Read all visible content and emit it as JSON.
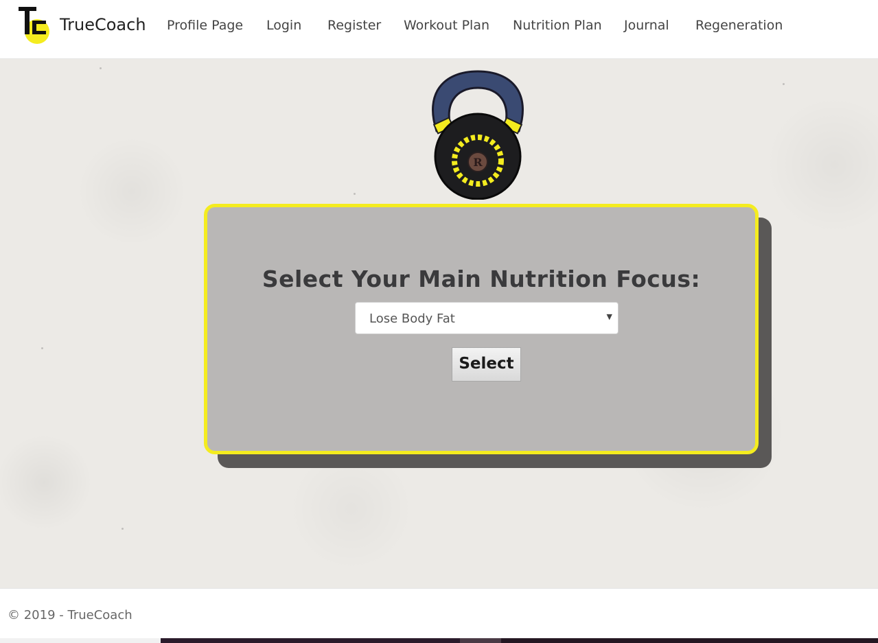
{
  "app": {
    "brand": "TrueCoach",
    "logo_letters": "TC",
    "accent_color": "#f4ec1f"
  },
  "nav": {
    "items": [
      {
        "label": "Profile Page"
      },
      {
        "label": "Login"
      },
      {
        "label": "Register"
      },
      {
        "label": "Workout Plan"
      },
      {
        "label": "Nutrition Plan"
      },
      {
        "label": "Journal"
      },
      {
        "label": "Regeneration"
      }
    ]
  },
  "hero": {
    "image": "kettlebell-logo-icon"
  },
  "form": {
    "title": "Select Your Main Nutrition Focus:",
    "select_value": "Lose Body Fat",
    "submit_label": "Select"
  },
  "footer": {
    "text": "© 2019 - TrueCoach"
  }
}
